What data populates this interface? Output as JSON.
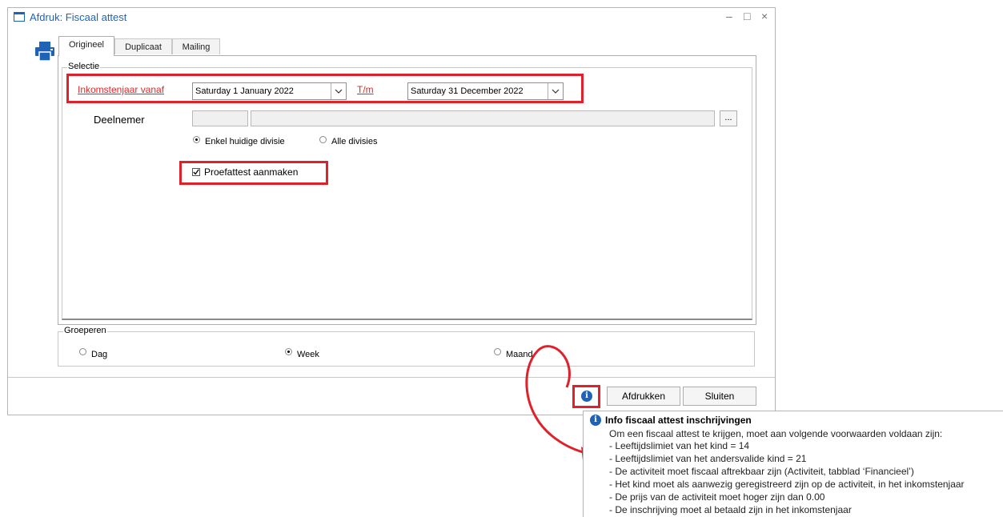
{
  "window": {
    "title": "Afdruk: Fiscaal attest",
    "controls": {
      "minimize": "–",
      "maximize": "□",
      "close": "×"
    }
  },
  "tabs": [
    {
      "label": "Origineel",
      "active": true
    },
    {
      "label": "Duplicaat",
      "active": false
    },
    {
      "label": "Mailing",
      "active": false
    }
  ],
  "selectie": {
    "legend": "Selectie",
    "income_year_from_label": "Inkomstenjaar vanaf",
    "date_from": "Saturday 1 January 2022",
    "to_label": "T/m",
    "date_to": "Saturday 31 December 2022",
    "participant_label": "Deelnemer",
    "participant_code": "",
    "participant_name": "",
    "browse_label": "...",
    "division_options": [
      {
        "label": "Enkel huidige divisie",
        "selected": true
      },
      {
        "label": "Alle divisies",
        "selected": false
      }
    ],
    "test_certificate_label": "Proefattest aanmaken",
    "test_certificate_checked": true
  },
  "groeperen": {
    "legend": "Groeperen",
    "options": [
      {
        "label": "Dag",
        "selected": false
      },
      {
        "label": "Week",
        "selected": true
      },
      {
        "label": "Maand",
        "selected": false
      }
    ]
  },
  "buttons": {
    "info": "i",
    "print": "Afdrukken",
    "close": "Sluiten"
  },
  "tooltip": {
    "title": "Info fiscaal attest inschrijvingen",
    "intro": "Om een fiscaal attest te krijgen, moet aan volgende voorwaarden voldaan zijn:",
    "lines": [
      "- Leeftijdslimiet van het kind = 14",
      "- Leeftijdslimiet van het andersvalide kind = 21",
      "- De activiteit moet fiscaal aftrekbaar zijn (Activiteit, tabblad ‘Financieel’)",
      "- Het kind moet als aanwezig geregistreerd zijn op de activiteit, in het inkomstenjaar",
      "- De prijs van de activiteit moet hoger zijn dan 0.00",
      "- De inschrijving moet al betaald zijn in het inkomstenjaar"
    ]
  },
  "colors": {
    "accent": "#1e63b8",
    "highlight": "#e0202a"
  }
}
